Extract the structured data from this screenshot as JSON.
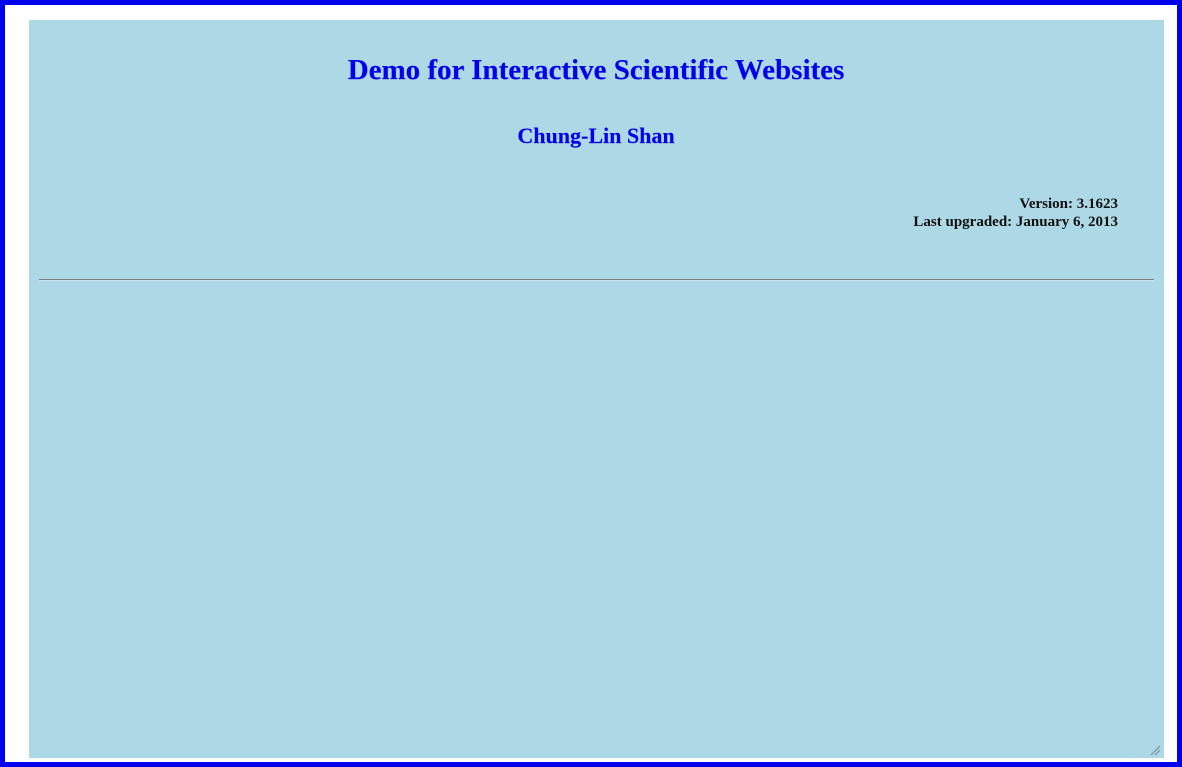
{
  "header": {
    "title": "Demo for Interactive Scientific Websites",
    "author": "Chung-Lin Shan"
  },
  "meta": {
    "version_line": "Version: 3.1623",
    "upgraded_line": "Last upgraded: January 6, 2013"
  },
  "colors": {
    "frame_border": "#0000ee",
    "panel_background": "#add8e6",
    "heading_text": "#0000ee",
    "body_text": "#111111",
    "divider": "#808080"
  },
  "icons": {
    "resize_grip": "resize-grip-icon"
  }
}
